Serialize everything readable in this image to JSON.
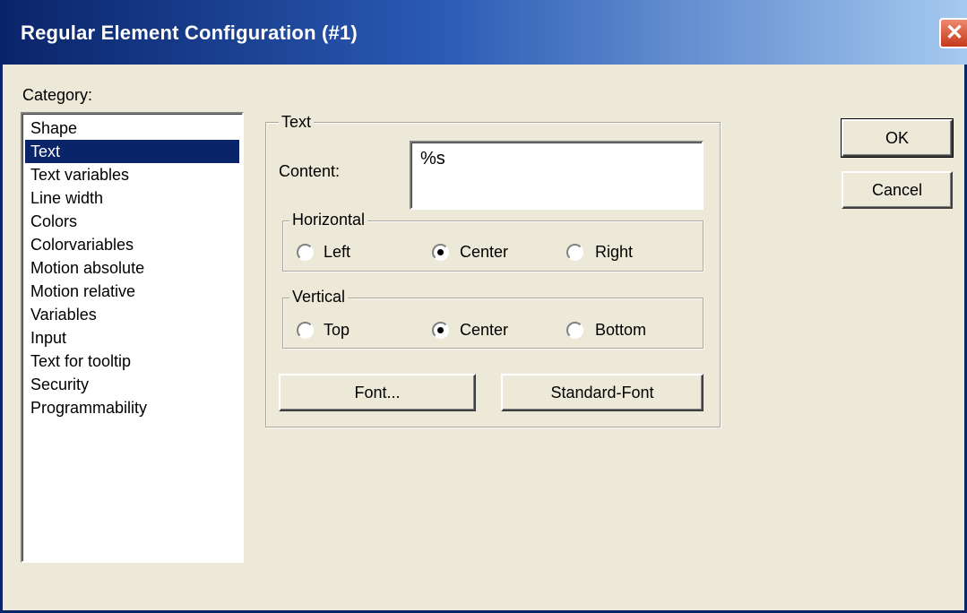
{
  "window": {
    "title": "Regular Element Configuration (#1)"
  },
  "category": {
    "label": "Category:",
    "items": [
      "Shape",
      "Text",
      "Text variables",
      "Line width",
      "Colors",
      "Colorvariables",
      "Motion absolute",
      "Motion relative",
      "Variables",
      "Input",
      "Text for tooltip",
      "Security",
      "Programmability"
    ],
    "selected": "Text"
  },
  "text_group": {
    "title": "Text",
    "content_label": "Content:",
    "content_value": "%s",
    "horizontal": {
      "title": "Horizontal",
      "options": [
        "Left",
        "Center",
        "Right"
      ],
      "selected": "Center"
    },
    "vertical": {
      "title": "Vertical",
      "options": [
        "Top",
        "Center",
        "Bottom"
      ],
      "selected": "Center"
    },
    "font_button": "Font...",
    "standard_font_button": "Standard-Font"
  },
  "buttons": {
    "ok": "OK",
    "cancel": "Cancel"
  },
  "icons": {
    "close": "close-icon"
  },
  "colors": {
    "title_bar_start": "#0a246a",
    "title_bar_end": "#a6caf0",
    "selection": "#0a246a",
    "close_button": "#c4381a"
  }
}
